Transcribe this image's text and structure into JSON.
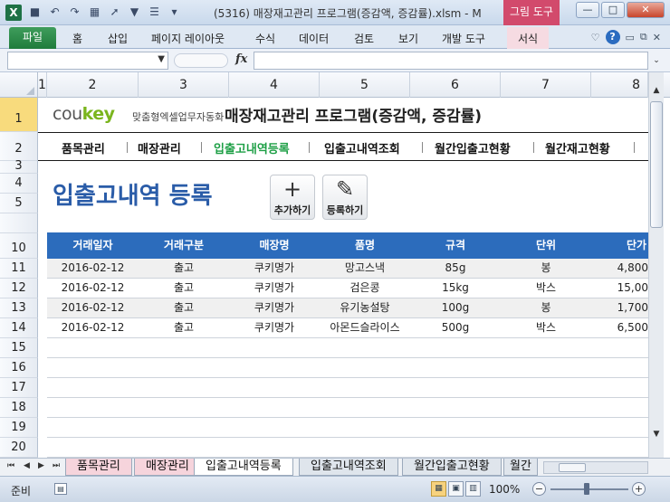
{
  "window": {
    "app_icon": "X",
    "title": "(5316) 매장재고관리 프로그램(증감액, 증감률).xlsm - M",
    "context_tab_group": "그림 도구"
  },
  "qat_icons": [
    "save-icon",
    "undo-icon",
    "redo-icon",
    "grid-icon",
    "pointer-icon",
    "filter-icon",
    "form-icon",
    "customize-icon"
  ],
  "ribbon": {
    "file_tab": "파일",
    "tabs": [
      "홈",
      "삽입",
      "페이지 레이아웃",
      "수식",
      "데이터",
      "검토",
      "보기",
      "개발 도구"
    ],
    "context_tab": "서식"
  },
  "formula_bar": {
    "name_box": "",
    "fx_label": "fx",
    "formula": ""
  },
  "columns": [
    "1",
    "2",
    "3",
    "4",
    "5",
    "6",
    "7",
    "8"
  ],
  "rows": [
    "1",
    "2",
    "3",
    "4",
    "5",
    "10",
    "11",
    "12",
    "13",
    "14",
    "15",
    "16",
    "17",
    "18",
    "19",
    "20"
  ],
  "sheet": {
    "brand": "coukey",
    "brand_sub": "맞춤형엑셀업무자동화",
    "title": "매장재고관리 프로그램(증감액, 증감률)",
    "nav": [
      "품목관리",
      "매장관리",
      "입출고내역등록",
      "입출고내역조회",
      "월간입출고현황",
      "월간재고현황"
    ],
    "heading": "입출고내역 등록",
    "add_button": "추가하기",
    "register_button": "등록하기",
    "table_headers": [
      "거래일자",
      "거래구분",
      "매장명",
      "품명",
      "규격",
      "단위",
      "단가"
    ],
    "table_rows": [
      [
        "2016-02-12",
        "출고",
        "쿠키명가",
        "망고스낵",
        "85g",
        "봉",
        "4,800"
      ],
      [
        "2016-02-12",
        "출고",
        "쿠키명가",
        "검은콩",
        "15kg",
        "박스",
        "15,00"
      ],
      [
        "2016-02-12",
        "출고",
        "쿠키명가",
        "유기농설탕",
        "100g",
        "봉",
        "1,700"
      ],
      [
        "2016-02-12",
        "출고",
        "쿠키명가",
        "아몬드슬라이스",
        "500g",
        "박스",
        "6,500"
      ]
    ]
  },
  "sheet_tabs": [
    "품목관리",
    "매장관리",
    "입출고내역등록",
    "입출고내역조회",
    "월간입출고현황",
    "월간"
  ],
  "status": {
    "ready": "준비",
    "zoom": "100%",
    "zoom_level": 1.0
  }
}
